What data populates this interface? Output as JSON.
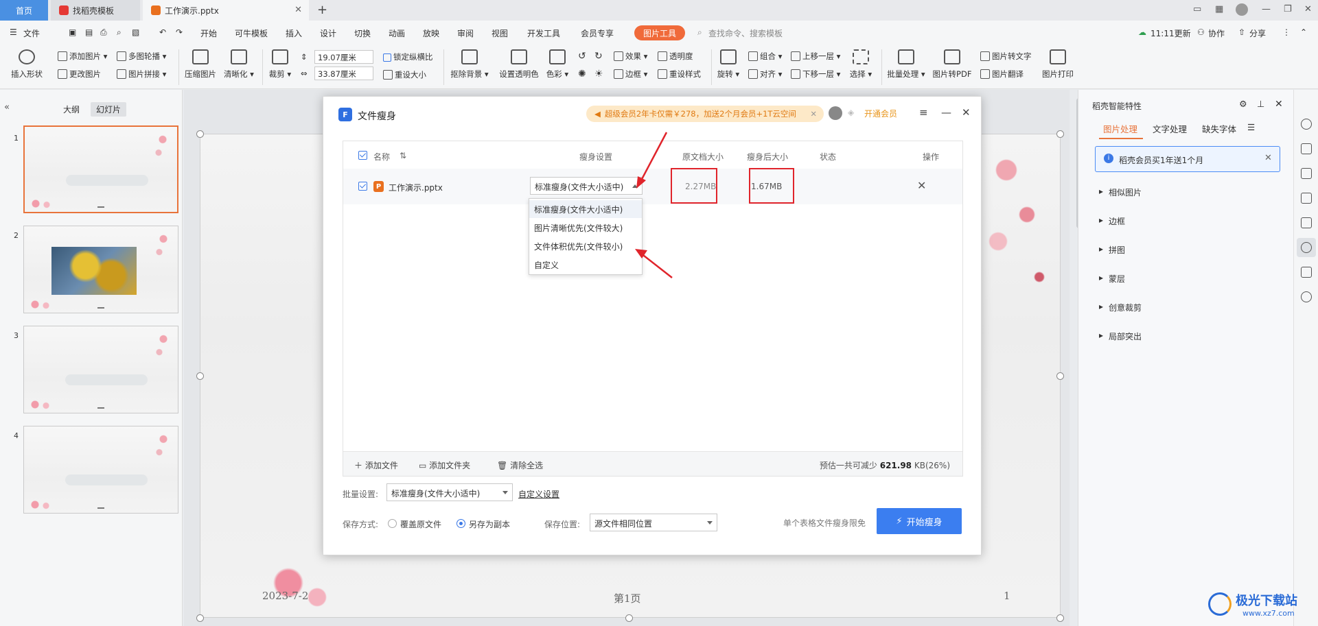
{
  "titlebar": {
    "home_tab": "首页",
    "tabs": [
      {
        "label": "找稻壳模板",
        "color": "#e53935"
      },
      {
        "label": "工作演示.pptx",
        "color": "#e9701f"
      }
    ],
    "new_tab_glyph": "+"
  },
  "menubar": {
    "file_label": "文件",
    "items": [
      "开始",
      "可牛模板",
      "插入",
      "设计",
      "切换",
      "动画",
      "放映",
      "审阅",
      "视图",
      "开发工具",
      "会员专享"
    ],
    "picture_tools": "图片工具",
    "search_placeholder": "查找命令、搜索模板",
    "update_label": "11:11更新",
    "collab_label": "协作",
    "share_label": "分享"
  },
  "ribbon": {
    "insert_shape": "插入形状",
    "add_picture": "添加图片",
    "multi_carousel": "多图轮播",
    "change_picture": "更改图片",
    "picture_collage": "图片拼接",
    "compress_picture": "压缩图片",
    "sharpen": "清晰化",
    "crop": "裁剪",
    "height_value": "19.07厘米",
    "width_value": "33.87厘米",
    "lock_ratio": "锁定纵横比",
    "reset_size": "重设大小",
    "remove_bg": "抠除背景",
    "set_transparent": "设置透明色",
    "color": "色彩",
    "effects": "效果",
    "transparency": "透明度",
    "border": "边框",
    "reset_style": "重设样式",
    "rotate": "旋转",
    "group": "组合",
    "align": "对齐",
    "bring_forward": "上移一层",
    "send_backward": "下移一层",
    "select": "选择",
    "batch": "批量处理",
    "to_pdf": "图片转PDF",
    "to_text": "图片转文字",
    "translate": "图片翻译",
    "print": "图片打印"
  },
  "leftpanel": {
    "tab_outline": "大纲",
    "tab_slides": "幻灯片",
    "slide_numbers": [
      "1",
      "2",
      "3",
      "4"
    ]
  },
  "slide": {
    "date_text": "2023-7-2",
    "page_text": "第1页",
    "number_text": "1"
  },
  "rightpanel": {
    "title": "稻壳智能特性",
    "tabs": [
      "图片处理",
      "文字处理",
      "缺失字体"
    ],
    "notice": "稻壳会员买1年送1个月",
    "items": [
      "相似图片",
      "边框",
      "拼图",
      "蒙层",
      "创意裁剪",
      "局部突出"
    ]
  },
  "dialog": {
    "title": "文件瘦身",
    "promo": "超级会员2年卡仅需￥278，加送2个月会员+1T云空间",
    "open_vip": "开通会员",
    "headers": {
      "name": "名称",
      "setting": "瘦身设置",
      "orig_size": "原文档大小",
      "new_size": "瘦身后大小",
      "status": "状态",
      "action": "操作"
    },
    "file": {
      "name": "工作演示.pptx",
      "setting": "标准瘦身(文件大小适中)",
      "orig_size": "2.27MB",
      "new_size": "1.67MB"
    },
    "dropdown_options": [
      "标准瘦身(文件大小适中)",
      "图片清晰优先(文件较大)",
      "文件体积优先(文件较小)",
      "自定义"
    ],
    "footer": {
      "add_file": "添加文件",
      "add_folder": "添加文件夹",
      "clear_all": "清除全选",
      "estimate_prefix": "预估一共可减少",
      "estimate_value": "621.98",
      "estimate_suffix": "KB(26%)"
    },
    "batch_label": "批量设置:",
    "batch_value": "标准瘦身(文件大小适中)",
    "custom_settings": "自定义设置",
    "save_mode_label": "保存方式:",
    "overwrite": "覆盖原文件",
    "save_copy": "另存为副本",
    "save_location_label": "保存位置:",
    "save_location_value": "源文件相同位置",
    "limit_note": "单个表格文件瘦身限免",
    "start_button": "开始瘦身"
  },
  "watermark": {
    "text": "极光下载站",
    "url": "www.xz7.com"
  },
  "colors": {
    "accent_orange": "#e8733a",
    "primary_blue": "#3b7ef0",
    "annotation_red": "#e0242b"
  }
}
